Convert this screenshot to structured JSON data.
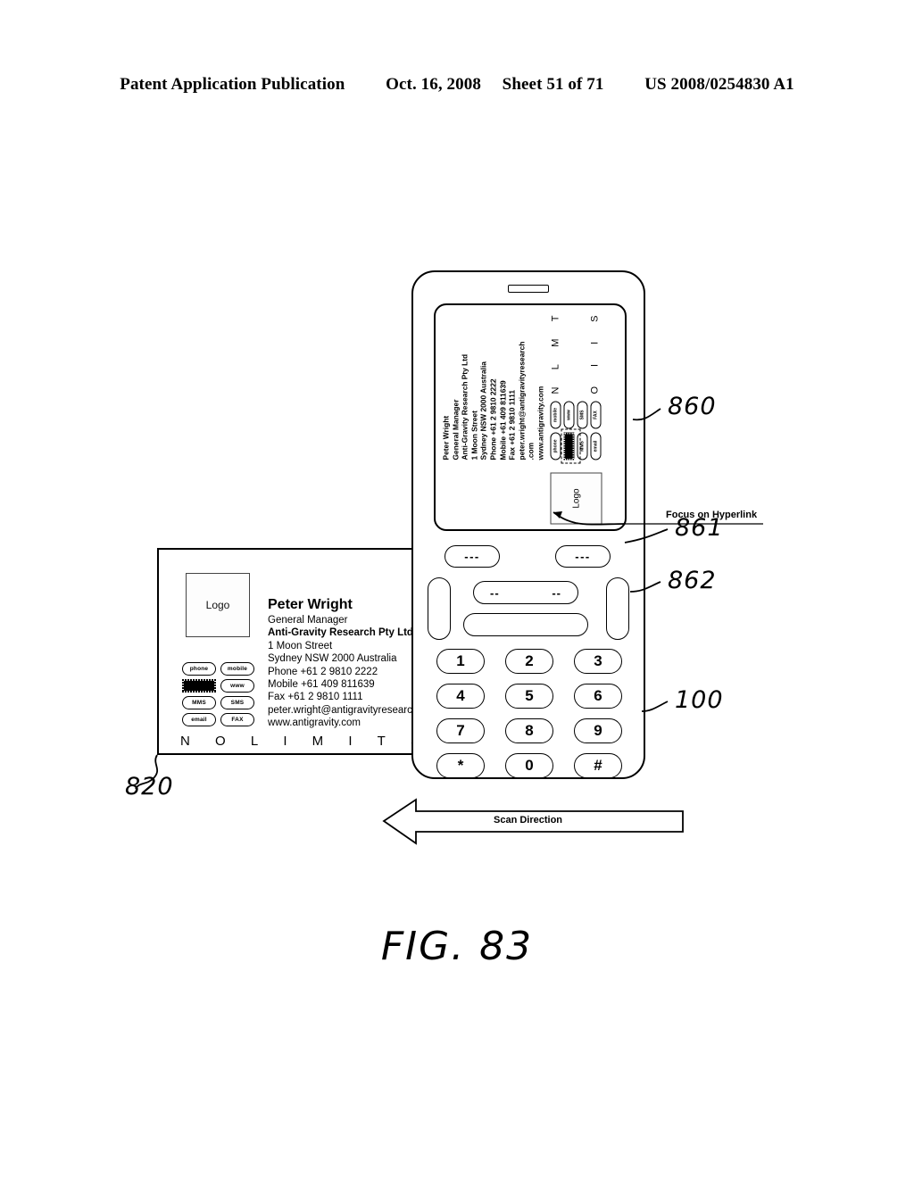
{
  "header": {
    "publication": "Patent Application Publication",
    "date": "Oct. 16, 2008",
    "sheet": "Sheet 51 of 71",
    "patent_number": "US 2008/0254830 A1"
  },
  "figure": {
    "caption": "FIG. 83"
  },
  "business_card": {
    "reference": "820",
    "logo_label": "Logo",
    "contact": {
      "name": "Peter Wright",
      "title": "General Manager",
      "company": "Anti-Gravity Research Pty Ltd",
      "street": "1 Moon Street",
      "city": "Sydney NSW 2000 Australia",
      "phone": "Phone +61 2 9810 2222",
      "mobile": "Mobile +61 409 811639",
      "fax": "Fax +61 2 9810 1111",
      "email": "peter.wright@antigravityresearch.com",
      "email_line1": "peter.wright@antigravityresearch",
      "email_line2": ".com",
      "website": "www.antigravity.com"
    },
    "buttons": [
      {
        "label": "phone",
        "type": "pill"
      },
      {
        "label": "mobile",
        "type": "pill"
      },
      {
        "label": "",
        "type": "barcode"
      },
      {
        "label": "www",
        "type": "pill"
      },
      {
        "label": "MMS",
        "type": "pill"
      },
      {
        "label": "SMS",
        "type": "pill"
      },
      {
        "label": "email",
        "type": "pill"
      },
      {
        "label": "FAX",
        "type": "pill"
      }
    ],
    "tagline_letters": [
      "N",
      "O",
      "L",
      "I",
      "M",
      "I",
      "T",
      "S"
    ]
  },
  "phone": {
    "reference": "100",
    "screen_reference": "860",
    "softkey_reference": "861",
    "sidekey_reference": "862",
    "softkeys": [
      {
        "label": "---"
      },
      {
        "label": "---"
      }
    ],
    "nav": {
      "left_label": "--",
      "right_label": "--"
    },
    "keypad": [
      [
        "1",
        "2",
        "3"
      ],
      [
        "4",
        "5",
        "6"
      ],
      [
        "7",
        "8",
        "9"
      ],
      [
        "*",
        "0",
        "#"
      ]
    ]
  },
  "annotations": {
    "focus_on_hyperlink": "Focus on Hyperlink",
    "scan_direction": "Scan Direction"
  },
  "colors": {
    "line": "#000000",
    "paper": "#ffffff"
  }
}
